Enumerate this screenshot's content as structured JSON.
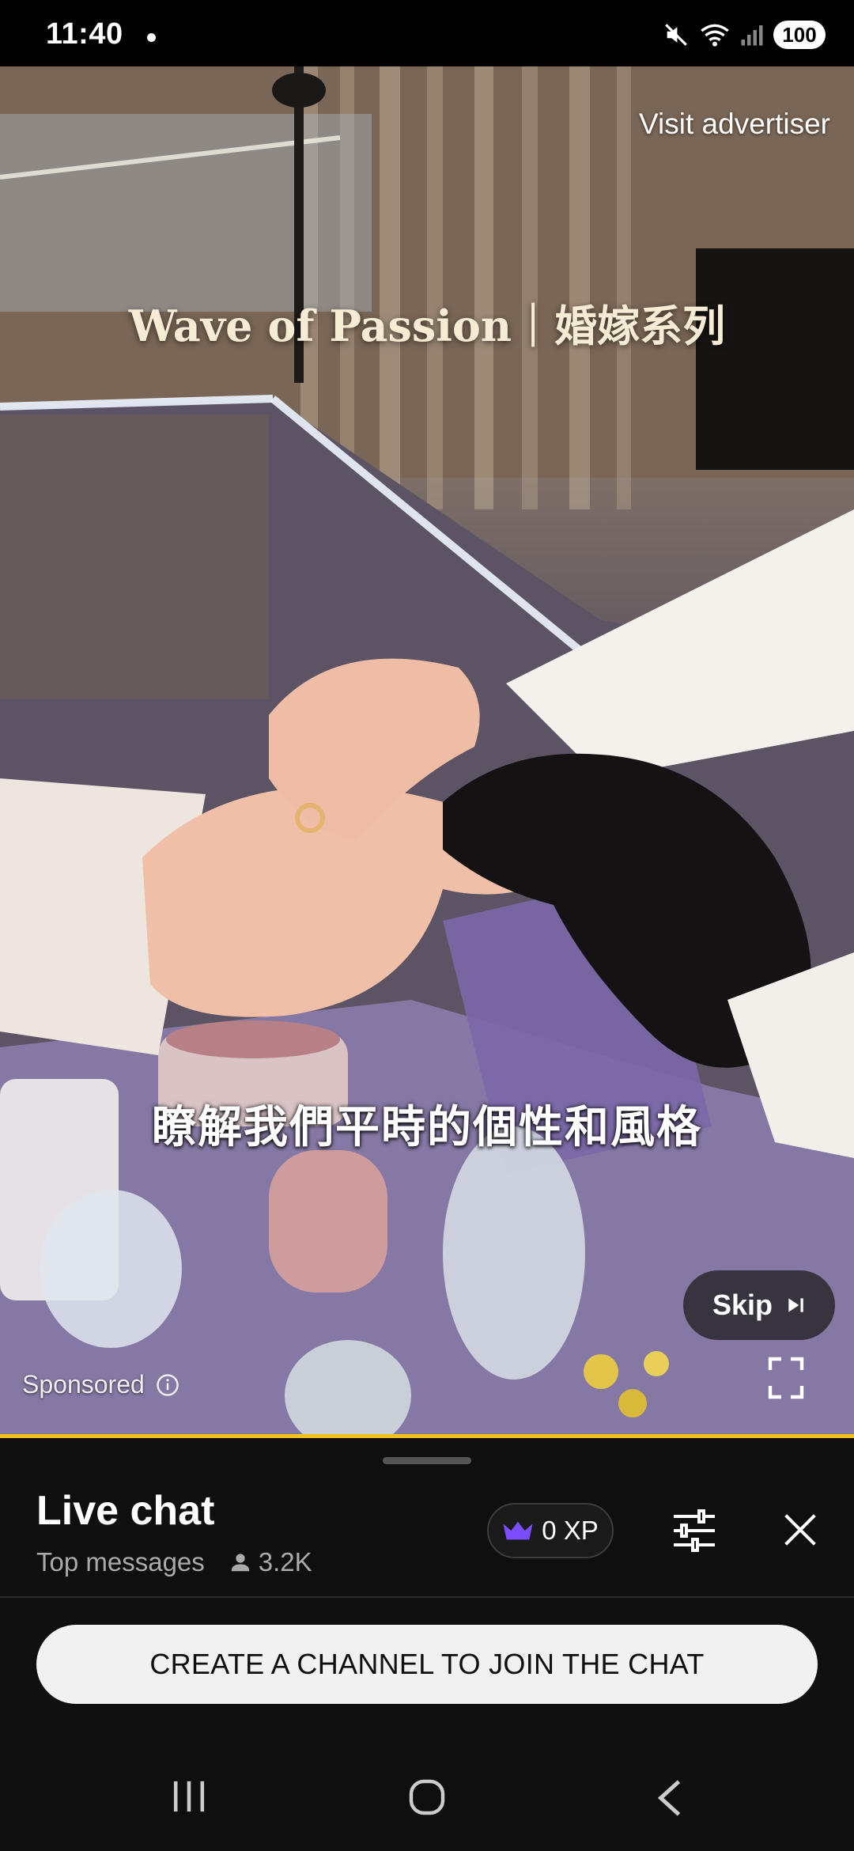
{
  "status_bar": {
    "time": "11:40",
    "battery": "100",
    "icons": [
      "mute-icon",
      "wifi-icon",
      "signal-icon",
      "battery-icon"
    ]
  },
  "video_ad": {
    "visit_advertiser": "Visit advertiser",
    "title_overlay": "Wave of Passion｜婚嫁系列",
    "subtitle": "瞭解我們平時的個性和風格",
    "skip_label": "Skip",
    "sponsored_label": "Sponsored",
    "progress_fraction": 1.0,
    "progress_color": "#f1c21b"
  },
  "live_chat": {
    "title": "Live chat",
    "mode": "Top messages",
    "viewer_count": "3.2K",
    "xp_label": "0 XP",
    "create_channel_label": "CREATE A CHANNEL TO JOIN THE CHAT"
  },
  "colors": {
    "background": "#0f0f0f",
    "crown": "#7b4dff",
    "button_bg": "#f1f1f1"
  }
}
